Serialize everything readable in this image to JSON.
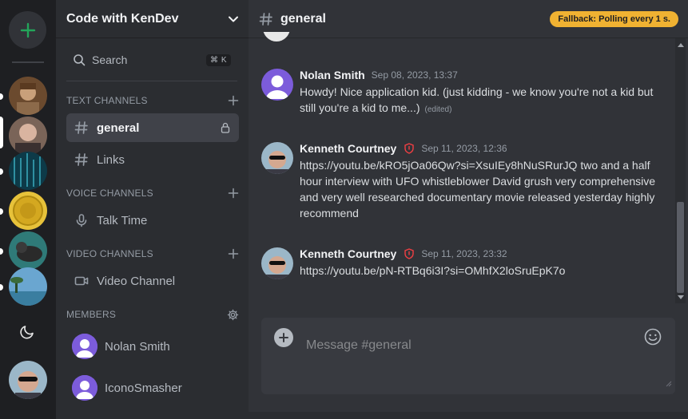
{
  "rail": {
    "add_server_label": "+",
    "servers": [
      {
        "name": "server-1",
        "color": "#7a5a3a"
      },
      {
        "name": "server-2",
        "color": "#8a6e5e"
      },
      {
        "name": "server-3",
        "color": "#1a5a6a"
      },
      {
        "name": "server-4",
        "color": "#d4a820"
      },
      {
        "name": "server-5",
        "color": "#3a6a5a"
      },
      {
        "name": "server-6",
        "color": "#4a8ab0"
      }
    ],
    "theme_icon": "moon-icon"
  },
  "sidebar": {
    "guild_name": "Code with KenDev",
    "search_label": "Search",
    "search_shortcut": "⌘ K",
    "categories": {
      "text": "TEXT CHANNELS",
      "voice": "VOICE CHANNELS",
      "video": "VIDEO CHANNELS",
      "members": "MEMBERS"
    },
    "channels": {
      "general": "general",
      "links": "Links",
      "talk_time": "Talk Time",
      "video_channel": "Video Channel"
    },
    "members": [
      "Nolan Smith",
      "IconoSmasher"
    ]
  },
  "main": {
    "channel_name": "general",
    "fallback_badge": "Fallback: Polling every 1 s.",
    "messages": [
      {
        "author": "Nolan Smith",
        "timestamp": "Sep 08, 2023, 13:37",
        "text": "Howdy! Nice application kid. (just kidding - we know you're not a kid but still you're a kid to me...)",
        "edited": "(edited)"
      },
      {
        "author": "Kenneth Courtney",
        "timestamp": "Sep 11, 2023, 12:36",
        "text": "https://youtu.be/kRO5jOa06Qw?si=XsuIEy8hNuSRurJQ two and a half hour interview with UFO whistleblower David grush very comprehensive and very well researched documentary movie released yesterday highly recommend"
      },
      {
        "author": "Kenneth Courtney",
        "timestamp": "Sep 11, 2023, 23:32",
        "text": "https://youtu.be/pN-RTBq6i3I?si=OMhfX2loSruEpK7o"
      }
    ],
    "composer_placeholder": "Message #general"
  },
  "colors": {
    "accent_green": "#23a55a",
    "badge_yellow": "#f0b232",
    "member_purple": "#7c5cdb",
    "admin_red": "#f23f43"
  }
}
